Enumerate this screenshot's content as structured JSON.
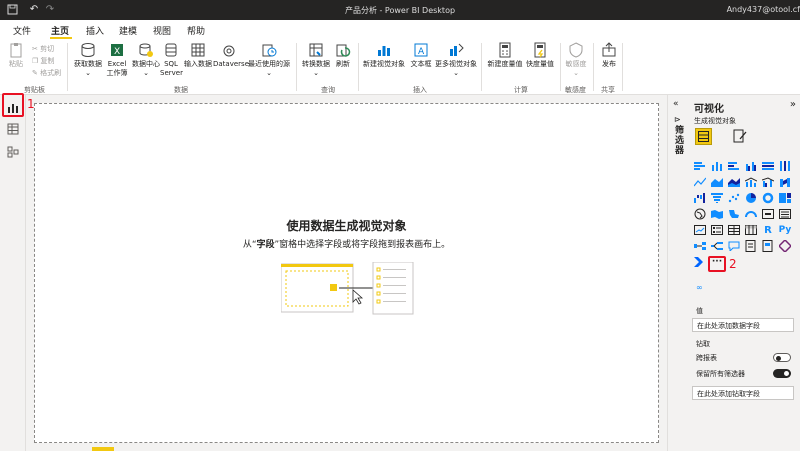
{
  "window": {
    "title": "产品分析 - Power BI Desktop",
    "user": "Andy437@otool.cf"
  },
  "menu": {
    "items": [
      "文件",
      "主页",
      "插入",
      "建模",
      "视图",
      "帮助"
    ],
    "active": "主页"
  },
  "ribbon": {
    "clipboard": {
      "paste": "粘贴",
      "cut": "剪切",
      "copy": "复制",
      "format_painter": "格式刷",
      "group": "剪贴板"
    },
    "data": {
      "get_data": "获取数据",
      "excel": "Excel",
      "excel2": "工作簿",
      "data_hub": "数据中心",
      "sql": "SQL",
      "sql2": "Server",
      "enter_data": "输入数据",
      "dataverse": "Dataverse",
      "recent": "最近使用的源",
      "group": "数据"
    },
    "query": {
      "transform": "转换数据",
      "refresh": "刷新",
      "group": "查询"
    },
    "insert": {
      "new_visual": "新建视觉对象",
      "textbox": "文本框",
      "more_visuals": "更多视觉对象",
      "group": "插入"
    },
    "calc": {
      "new_measure": "新建度量值",
      "quick_measure": "快度量值",
      "group": "计算"
    },
    "sensitivity": {
      "label": "敏感度",
      "group": "敏感度"
    },
    "share": {
      "publish": "发布",
      "group": "共享"
    }
  },
  "annotations": {
    "one": "1",
    "two": "2"
  },
  "canvas": {
    "heading": "使用数据生成视觉对象",
    "sub_prefix": "从“",
    "sub_bold": "字段",
    "sub_suffix": "”窗格中选择字段或将字段拖到报表画布上。"
  },
  "filters": {
    "label": "筛选器"
  },
  "viz": {
    "title": "可视化",
    "build": "生成视觉对象",
    "values_label": "值",
    "values_field": "在此处添加数据字段",
    "drill_label": "钻取",
    "cross_report": "跨报表",
    "keep_filters": "保留所有筛选器",
    "drill_field": "在此处添加钻取字段"
  },
  "colors": {
    "accent": "#f2c811",
    "red": "#e81123",
    "titlebar": "#252423"
  }
}
